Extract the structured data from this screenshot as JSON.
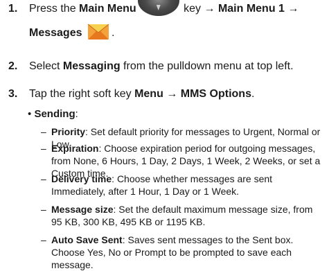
{
  "steps": [
    {
      "num": "1.",
      "pre": "Press the ",
      "b1": "Main Menu",
      "mid": " key",
      "arrow1": " → ",
      "b2": "Main Menu 1",
      "arrow2": " →",
      "b3": "Messages",
      "end": "."
    },
    {
      "num": "2.",
      "pre": "Select ",
      "b1": "Messaging",
      "post": " from the pulldown menu at top left."
    },
    {
      "num": "3.",
      "pre": "Tap the right soft key ",
      "b1": "Menu",
      "arrow": " → ",
      "b2": "MMS Options",
      "end": "."
    }
  ],
  "bullet": {
    "dot": "•",
    "label": "Sending",
    "colon": ":"
  },
  "options": [
    {
      "dash": "–",
      "name": "Priority",
      "text": ": Set default priority for messages to Urgent, Normal or Low."
    },
    {
      "dash": "–",
      "name": "Expiration",
      "text": ": Choose expiration period for outgoing messages, from None, 6 Hours, 1 Day, 2 Days, 1 Week, 2 Weeks, or set a Custom time."
    },
    {
      "dash": "–",
      "name": "Delivery time",
      "text": ": Choose whether messages are sent Immediately, after 1 Hour, 1 Day or 1 Week."
    },
    {
      "dash": "–",
      "name": "Message size",
      "text": ": Set the default maximum message size, from  95 KB, 300 KB, 495 KB or 1195 KB."
    },
    {
      "dash": "–",
      "name": "Auto Save Sent",
      "text": ": Saves sent messages to the Sent box. Choose Yes, No or Prompt to be prompted to save each message."
    }
  ],
  "icons": {
    "key": "main-menu-key-icon",
    "messages": "messages-envelope-icon"
  },
  "colors": {
    "text": "#1a1a1a",
    "envelope_orange": "#f08a24",
    "envelope_yellow": "#f7d251",
    "key_gray": "#4a4a4a"
  }
}
